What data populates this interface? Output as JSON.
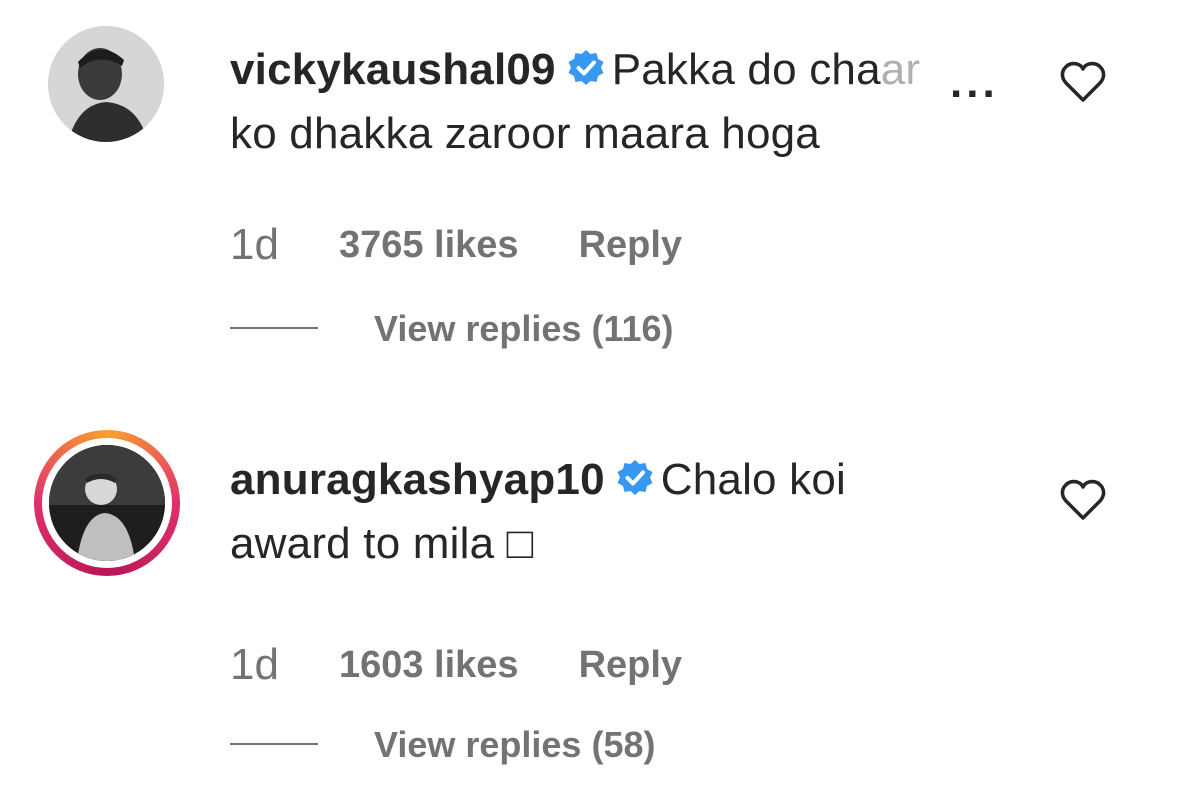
{
  "comments": [
    {
      "username": "vickykaushal09",
      "text_line1": "Pakka do cha",
      "text_fade": "ar",
      "more": "...",
      "text_line2": "ko dhakka zaroor maara hoga",
      "time": "1d",
      "likes": "3765 likes",
      "reply": "Reply",
      "view_replies": "View replies (116)"
    },
    {
      "username": "anuragkashyap10",
      "text_line1": "Chalo koi",
      "text_line2": "award to mila □",
      "time": "1d",
      "likes": "1603 likes",
      "reply": "Reply",
      "view_replies": "View replies (58)"
    }
  ],
  "colors": {
    "verified": "#3897f0",
    "story_ring_start": "#f9a12e",
    "story_ring_end": "#e1306c",
    "meta_text": "#737373"
  },
  "icons": {
    "verified": "verified-badge-icon",
    "like": "heart-outline-icon"
  }
}
